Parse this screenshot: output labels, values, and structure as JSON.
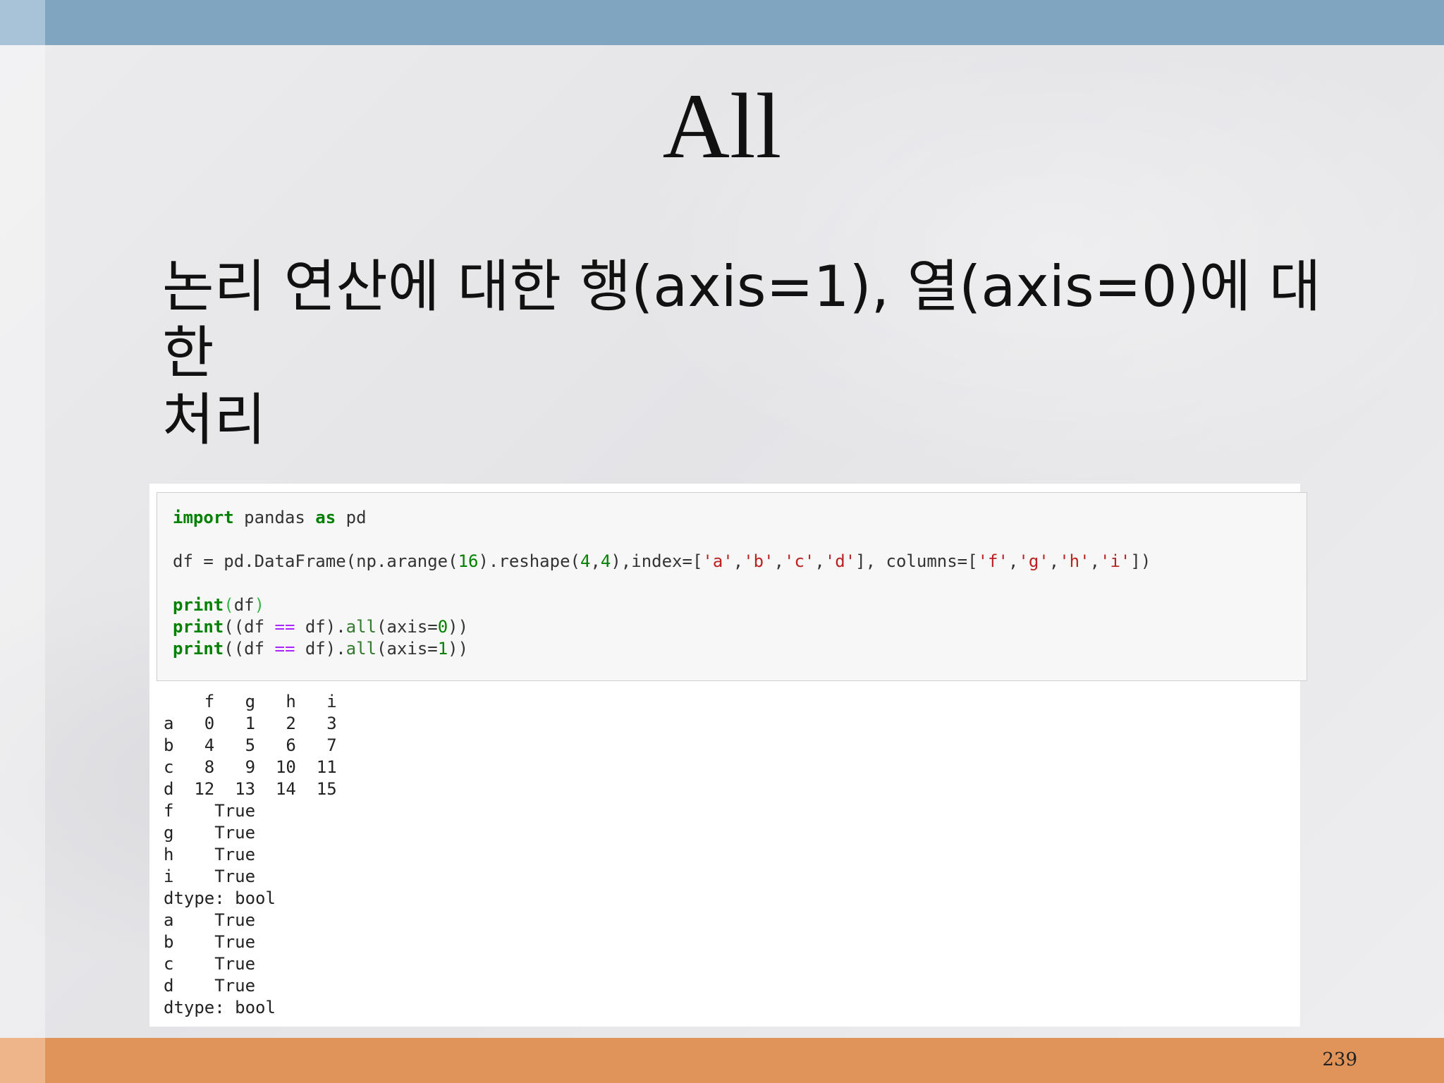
{
  "slide": {
    "title": "All",
    "bullet_line1": "논리 연산에 대한 행(axis=1), 열(axis=0)에 대한",
    "bullet_line2": "처리",
    "page_number": "239"
  },
  "code": {
    "line1": {
      "kw1": "import",
      "mid": " pandas ",
      "kw2": "as",
      "end": " pd"
    },
    "line2": {
      "a": "df = pd.DataFrame(np.arange(",
      "n16": "16",
      "b": ").reshape(",
      "n4a": "4",
      "comma1": ",",
      "n4b": "4",
      "c": "),index=[",
      "sa": "'a'",
      "sb": "'b'",
      "sc": "'c'",
      "sd": "'d'",
      "d": "], columns=[",
      "sf": "'f'",
      "sg": "'g'",
      "sh": "'h'",
      "si": "'i'",
      "e": "])"
    },
    "line3": {
      "kw": "print",
      "open": "(",
      "arg": "df",
      "close": ")"
    },
    "line4": {
      "kw": "print",
      "a": "((df ",
      "op": "==",
      "b": " df).",
      "attr": "all",
      "c": "(axis=",
      "num": "0",
      "d": "))"
    },
    "line5": {
      "kw": "print",
      "a": "((df ",
      "op": "==",
      "b": " df).",
      "attr": "all",
      "c": "(axis=",
      "num": "1",
      "d": "))"
    }
  },
  "output": {
    "lines": [
      "    f   g   h   i",
      "a   0   1   2   3",
      "b   4   5   6   7",
      "c   8   9  10  11",
      "d  12  13  14  15",
      "f    True",
      "g    True",
      "h    True",
      "i    True",
      "dtype: bool",
      "a    True",
      "b    True",
      "c    True",
      "d    True",
      "dtype: bool"
    ]
  },
  "colors": {
    "top_bar": "#7fa5c1",
    "bottom_bar": "#e09459",
    "keyword": "#008000",
    "string": "#ba2121",
    "operator": "#aa22ff"
  }
}
